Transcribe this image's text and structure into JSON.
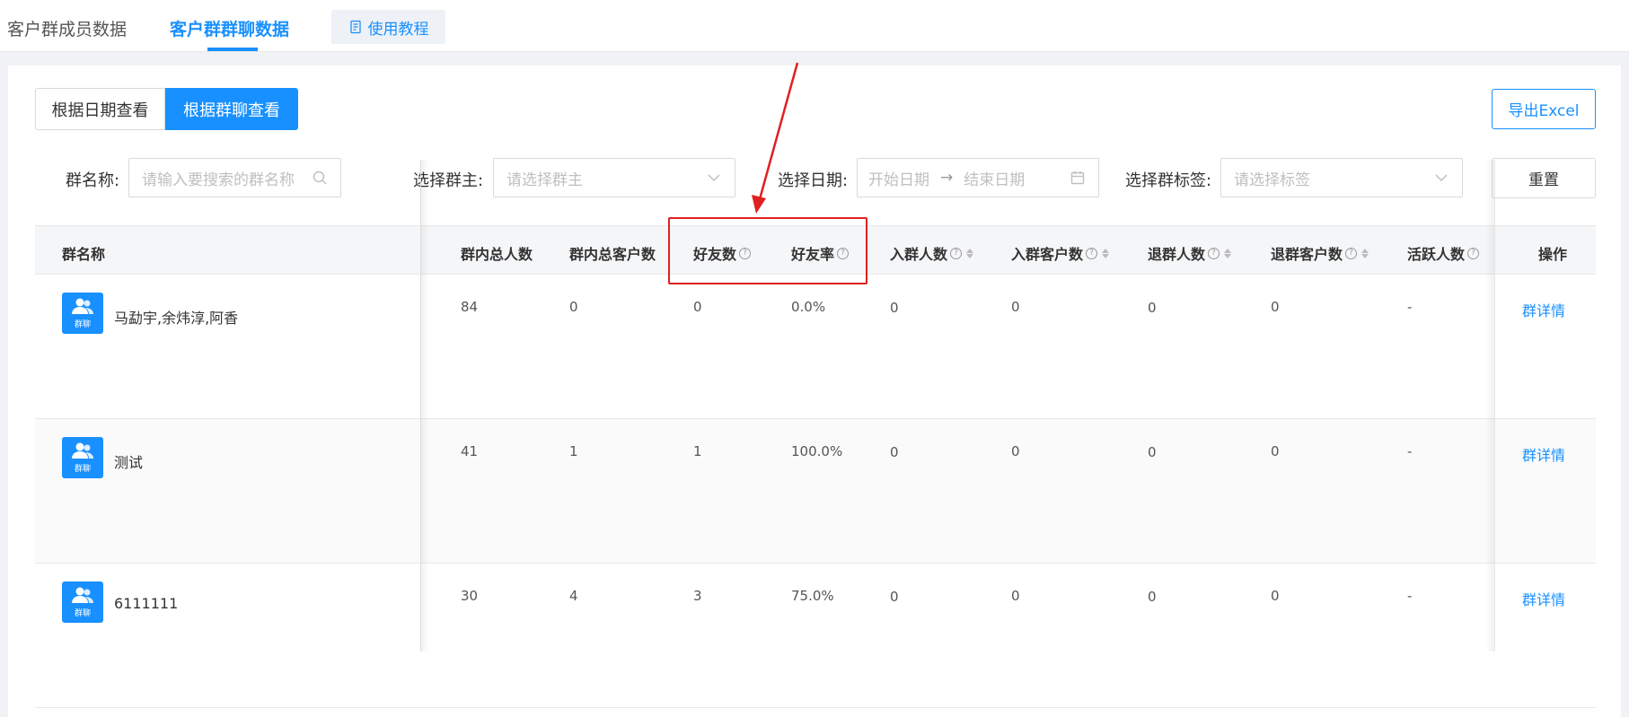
{
  "tabs": {
    "members": "客户群成员数据",
    "chats": "客户群群聊数据",
    "tutorial": "使用教程"
  },
  "view_toggle": {
    "by_date": "根据日期查看",
    "by_chat": "根据群聊查看"
  },
  "export_label": "导出Excel",
  "reset_label": "重置",
  "filters": {
    "name_label": "群名称:",
    "name_placeholder": "请输入要搜索的群名称",
    "owner_label": "选择群主:",
    "owner_placeholder": "请选择群主",
    "date_label": "选择日期:",
    "start_placeholder": "开始日期",
    "end_placeholder": "结束日期",
    "tag_label": "选择群标签:",
    "tag_placeholder": "请选择标签"
  },
  "table": {
    "headers": [
      "群名称",
      "群内总人数",
      "群内总客户数",
      "好友数",
      "好友率",
      "入群人数",
      "入群客户数",
      "退群人数",
      "退群客户数",
      "活跃人数",
      "操作"
    ],
    "group_icon_label": "群聊",
    "rows": [
      {
        "name": "马勐宇,余炜淳,阿香",
        "total": "84",
        "customers": "0",
        "friends": "0",
        "rate": "0.0%",
        "joined": "0",
        "joined_customers": "0",
        "left": "0",
        "left_customers": "0",
        "active": "-",
        "action": "群详情"
      },
      {
        "name": "测试",
        "total": "41",
        "customers": "1",
        "friends": "1",
        "rate": "100.0%",
        "joined": "0",
        "joined_customers": "0",
        "left": "0",
        "left_customers": "0",
        "active": "-",
        "action": "群详情"
      },
      {
        "name": "6111111",
        "total": "30",
        "customers": "4",
        "friends": "3",
        "rate": "75.0%",
        "joined": "0",
        "joined_customers": "0",
        "left": "0",
        "left_customers": "0",
        "active": "-",
        "action": "群详情"
      }
    ]
  },
  "colors": {
    "accent": "#1890ff",
    "annotation": "#e02020"
  }
}
